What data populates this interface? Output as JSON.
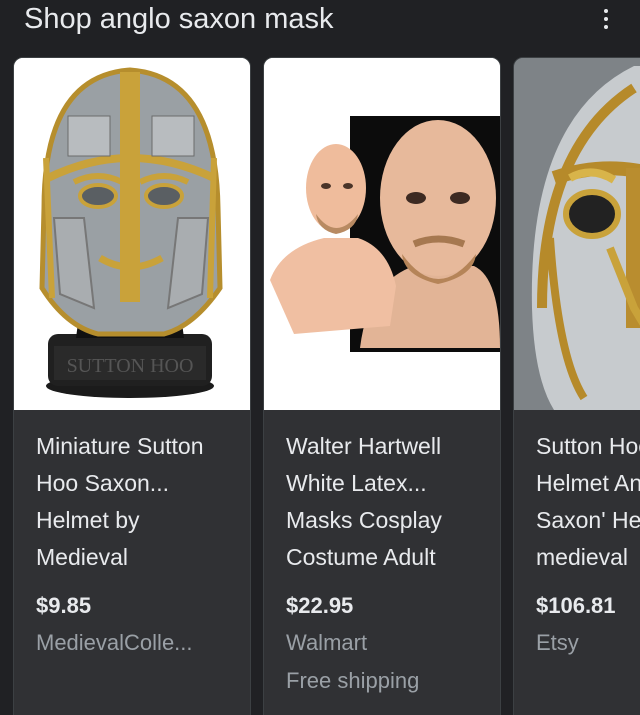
{
  "header": {
    "title": "Shop anglo saxon mask",
    "more_icon": "more-vert-icon"
  },
  "products": [
    {
      "name": "Miniature Sutton\nHoo Saxon...\nHelmet by\nMedieval",
      "price": "$9.85",
      "merchant": "MedievalColle...",
      "image_label": "SUTTON HOO"
    },
    {
      "name": "Walter Hartwell\nWhite Latex...\nMasks Cosplay\nCostume Adult",
      "price": "$22.95",
      "merchant": "Walmart",
      "shipping": "Free shipping"
    },
    {
      "name": "Sutton Hoo\nHelmet Anglo\nSaxon' Helmet\nmedieval",
      "price": "$106.81",
      "merchant": "Etsy"
    }
  ]
}
